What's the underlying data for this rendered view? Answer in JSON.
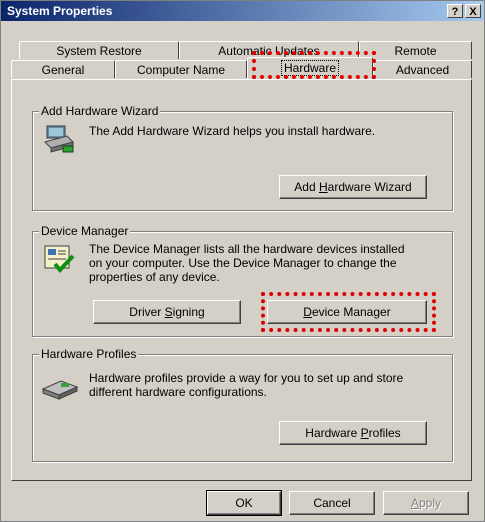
{
  "window": {
    "title": "System Properties",
    "help_button": "?",
    "close_button": "X"
  },
  "tabs": {
    "row1": [
      "System Restore",
      "Automatic Updates",
      "Remote"
    ],
    "row2": [
      "General",
      "Computer Name",
      "Hardware",
      "Advanced"
    ],
    "selected": "Hardware"
  },
  "add_hardware": {
    "legend": "Add Hardware Wizard",
    "description": "The Add Hardware Wizard helps you install hardware.",
    "button_pre": "Add ",
    "button_key": "H",
    "button_post": "ardware Wizard"
  },
  "device_manager": {
    "legend": "Device Manager",
    "description_lines": [
      "The Device Manager lists all the hardware devices installed",
      "on your computer. Use the Device Manager to change the",
      "properties of any device."
    ],
    "driver_signing_pre": "Driver ",
    "driver_signing_key": "S",
    "driver_signing_post": "igning",
    "device_manager_pre": "",
    "device_manager_key": "D",
    "device_manager_post": "evice Manager"
  },
  "hardware_profiles": {
    "legend": "Hardware Profiles",
    "description_lines": [
      "Hardware profiles provide a way for you to set up and store",
      "different hardware configurations."
    ],
    "button_pre": "Hardware ",
    "button_key": "P",
    "button_post": "rofiles"
  },
  "footer": {
    "ok": "OK",
    "cancel": "Cancel",
    "apply_key": "A",
    "apply_post": "pply"
  },
  "annotations": {
    "highlight_color": "#e00000",
    "highlighted": [
      "Hardware tab",
      "Device Manager button"
    ]
  }
}
